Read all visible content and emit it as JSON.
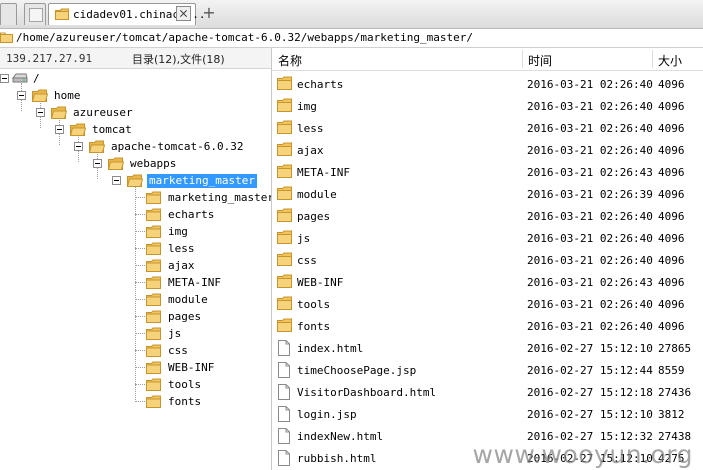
{
  "tabs": {
    "active_label": "cidadev01.chinacl..."
  },
  "path": "/home/azureuser/tomcat/apache-tomcat-6.0.32/webapps/marketing_master/",
  "left_panel": {
    "host_ip": "139.217.27.91",
    "summary": "目录(12),文件(18)"
  },
  "tree": {
    "root": "/",
    "home": "home",
    "azureuser": "azureuser",
    "tomcat": "tomcat",
    "apache": "apache-tomcat-6.0.32",
    "webapps": "webapps",
    "selected": "marketing_master",
    "children": [
      "marketing_master",
      "echarts",
      "img",
      "less",
      "ajax",
      "META-INF",
      "module",
      "pages",
      "js",
      "css",
      "WEB-INF",
      "tools",
      "fonts"
    ]
  },
  "columns": {
    "name": "名称",
    "time": "时间",
    "size": "大小"
  },
  "files": [
    {
      "name": "echarts",
      "time": "2016-03-21 02:26:40",
      "size": "4096",
      "type": "folder"
    },
    {
      "name": "img",
      "time": "2016-03-21 02:26:40",
      "size": "4096",
      "type": "folder"
    },
    {
      "name": "less",
      "time": "2016-03-21 02:26:40",
      "size": "4096",
      "type": "folder"
    },
    {
      "name": "ajax",
      "time": "2016-03-21 02:26:40",
      "size": "4096",
      "type": "folder"
    },
    {
      "name": "META-INF",
      "time": "2016-03-21 02:26:43",
      "size": "4096",
      "type": "folder"
    },
    {
      "name": "module",
      "time": "2016-03-21 02:26:39",
      "size": "4096",
      "type": "folder"
    },
    {
      "name": "pages",
      "time": "2016-03-21 02:26:40",
      "size": "4096",
      "type": "folder"
    },
    {
      "name": "js",
      "time": "2016-03-21 02:26:40",
      "size": "4096",
      "type": "folder"
    },
    {
      "name": "css",
      "time": "2016-03-21 02:26:40",
      "size": "4096",
      "type": "folder"
    },
    {
      "name": "WEB-INF",
      "time": "2016-03-21 02:26:43",
      "size": "4096",
      "type": "folder"
    },
    {
      "name": "tools",
      "time": "2016-03-21 02:26:40",
      "size": "4096",
      "type": "folder"
    },
    {
      "name": "fonts",
      "time": "2016-03-21 02:26:40",
      "size": "4096",
      "type": "folder"
    },
    {
      "name": "index.html",
      "time": "2016-02-27 15:12:10",
      "size": "27865",
      "type": "file"
    },
    {
      "name": "timeChoosePage.jsp",
      "time": "2016-02-27 15:12:44",
      "size": "8559",
      "type": "file"
    },
    {
      "name": "VisitorDashboard.html",
      "time": "2016-02-27 15:12:18",
      "size": "27436",
      "type": "file"
    },
    {
      "name": "login.jsp",
      "time": "2016-02-27 15:12:10",
      "size": "3812",
      "type": "file"
    },
    {
      "name": "indexNew.html",
      "time": "2016-02-27 15:12:32",
      "size": "27438",
      "type": "file"
    },
    {
      "name": "rubbish.html",
      "time": "2016-02-27 15:12:10",
      "size": "4275",
      "type": "file"
    }
  ],
  "watermark": "www.wooyun.org",
  "colors": {
    "selection": "#3399ff",
    "folder": "#f2c55c",
    "folder_dark": "#d9a23a"
  }
}
